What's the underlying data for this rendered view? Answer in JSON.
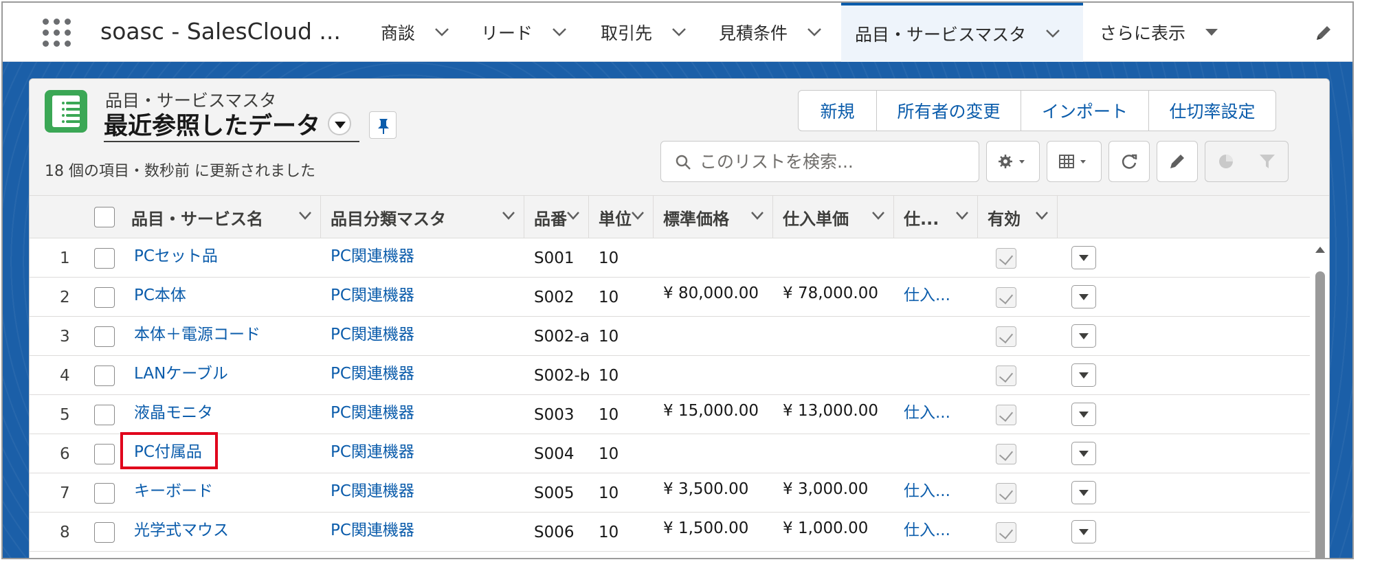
{
  "app": {
    "name": "soasc - SalesCloud ...",
    "nav_tabs": [
      {
        "label": "商談"
      },
      {
        "label": "リード"
      },
      {
        "label": "取引先"
      },
      {
        "label": "見積条件"
      },
      {
        "label": "品目・サービスマスタ",
        "active": true
      },
      {
        "label": "さらに表示"
      }
    ]
  },
  "list_view": {
    "object_label": "品目・サービスマスタ",
    "title": "最近参照したデータ",
    "meta": "18 個の項目・数秒前 に更新されました",
    "buttons": [
      "新規",
      "所有者の変更",
      "インポート",
      "仕切率設定"
    ],
    "search_placeholder": "このリストを検索..."
  },
  "table": {
    "columns": [
      "品目・サービス名",
      "品目分類マスタ",
      "品番",
      "単位",
      "標準価格",
      "仕入単価",
      "仕...",
      "有効"
    ],
    "rows": [
      {
        "num": "1",
        "name": "PCセット品",
        "category": "PC関連機器",
        "code": "S001",
        "unit": "10",
        "price": "",
        "cost": "",
        "extra": "",
        "active": true
      },
      {
        "num": "2",
        "name": "PC本体",
        "category": "PC関連機器",
        "code": "S002",
        "unit": "10",
        "price": "¥ 80,000.00",
        "cost": "¥ 78,000.00",
        "extra": "仕入...",
        "active": true
      },
      {
        "num": "3",
        "name": "本体＋電源コード",
        "category": "PC関連機器",
        "code": "S002-a",
        "unit": "10",
        "price": "",
        "cost": "",
        "extra": "",
        "active": true
      },
      {
        "num": "4",
        "name": "LANケーブル",
        "category": "PC関連機器",
        "code": "S002-b",
        "unit": "10",
        "price": "",
        "cost": "",
        "extra": "",
        "active": true
      },
      {
        "num": "5",
        "name": "液晶モニタ",
        "category": "PC関連機器",
        "code": "S003",
        "unit": "10",
        "price": "¥ 15,000.00",
        "cost": "¥ 13,000.00",
        "extra": "仕入...",
        "active": true
      },
      {
        "num": "6",
        "name": "PC付属品",
        "category": "PC関連機器",
        "code": "S004",
        "unit": "10",
        "price": "",
        "cost": "",
        "extra": "",
        "active": true,
        "highlighted": true
      },
      {
        "num": "7",
        "name": "キーボード",
        "category": "PC関連機器",
        "code": "S005",
        "unit": "10",
        "price": "¥ 3,500.00",
        "cost": "¥ 3,000.00",
        "extra": "仕入...",
        "active": true
      },
      {
        "num": "8",
        "name": "光学式マウス",
        "category": "PC関連機器",
        "code": "S006",
        "unit": "10",
        "price": "¥ 1,500.00",
        "cost": "¥ 1,000.00",
        "extra": "仕入...",
        "active": true
      }
    ]
  },
  "colors": {
    "brand_blue": "#0b5cab",
    "band_blue": "#1b5fa8",
    "highlight_red": "#e0001b",
    "icon_green": "#3ba755"
  },
  "icons": [
    "app-launcher-icon",
    "chevron-down-icon",
    "pencil-icon",
    "list-object-icon",
    "pin-icon",
    "search-icon",
    "gear-icon",
    "table-icon",
    "refresh-icon",
    "chart-icon",
    "filter-icon"
  ]
}
